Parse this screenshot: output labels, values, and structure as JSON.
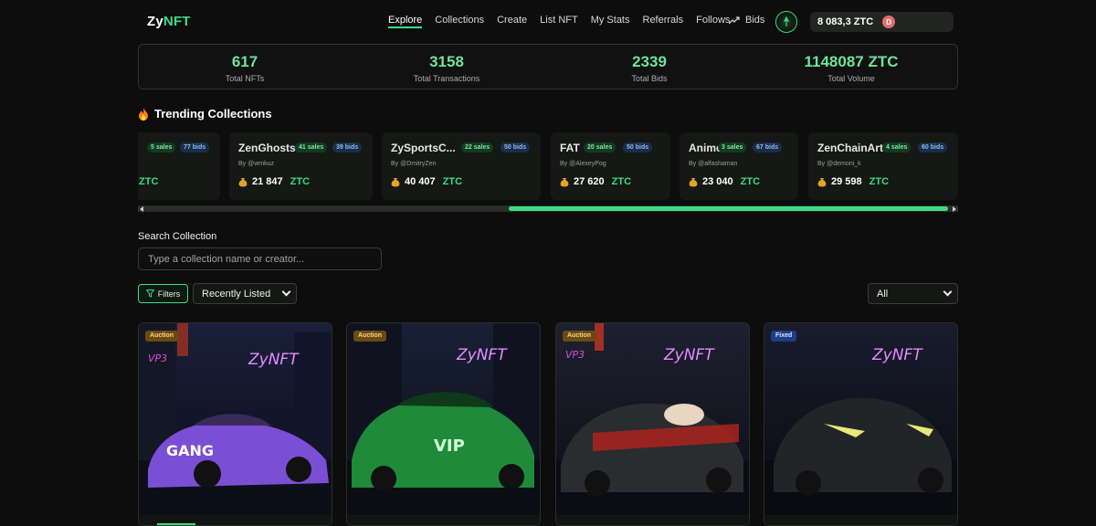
{
  "header": {
    "logo_part1": "Zy",
    "logo_part2": "NFT",
    "nav": [
      "Explore",
      "Collections",
      "Create",
      "List NFT",
      "My Stats",
      "Referrals",
      "Follows"
    ],
    "bids_label": "Bids",
    "wallet_amount": "8 083,3 ZTC",
    "user_initial": "D"
  },
  "stats": [
    {
      "value": "617",
      "label": "Total NFTs"
    },
    {
      "value": "3158",
      "label": "Total Transactions"
    },
    {
      "value": "2339",
      "label": "Total Bids"
    },
    {
      "value": "1148087 ZTC",
      "label": "Total Volume"
    }
  ],
  "trending": {
    "title": "Trending Collections",
    "partial_card": {
      "sales": "5 sales",
      "bids": "77 bids",
      "currency": "ZTC"
    },
    "cards": [
      {
        "name": "ZenGhosts",
        "sales": "41 sales",
        "bids": "39 bids",
        "by": "By @wmkuz",
        "volume": "21 847",
        "currency": "ZTC"
      },
      {
        "name": "ZySportsC...",
        "sales": "22 sales",
        "bids": "50 bids",
        "by": "By @DmitryZen",
        "volume": "40 407",
        "currency": "ZTC"
      },
      {
        "name": "FAT",
        "sales": "20 sales",
        "bids": "50 bids",
        "by": "By @AlexeyPog",
        "volume": "27 620",
        "currency": "ZTC"
      },
      {
        "name": "Anime",
        "sales": "3 sales",
        "bids": "67 bids",
        "by": "By @alfashaman",
        "volume": "23 040",
        "currency": "ZTC"
      },
      {
        "name": "ZenChainArt",
        "sales": "4 sales",
        "bids": "60 bids",
        "by": "By @demoni_k",
        "volume": "29 598",
        "currency": "ZTC"
      }
    ]
  },
  "search": {
    "label": "Search Collection",
    "placeholder": "Type a collection name or creator..."
  },
  "toolbar": {
    "filters_label": "Filters",
    "sort_value": "Recently Listed",
    "type_value": "All"
  },
  "nfts": [
    {
      "badge": "Auction",
      "sign": "ZyNFT",
      "car_color": "#7b4fd4",
      "car_decal": "GANG",
      "side_text": "VP3"
    },
    {
      "badge": "Auction",
      "sign": "ZyNFT",
      "car_color": "#1f8a3a",
      "car_decal": "VIP"
    },
    {
      "badge": "Auction",
      "sign": "ZyNFT",
      "car_color": "#2b2c30",
      "side_text": "VP3"
    },
    {
      "badge": "Fixed",
      "sign": "ZyNFT",
      "car_color": "#232428"
    }
  ],
  "colors": {
    "accent": "#3ddc84",
    "background": "#0c0d0c"
  }
}
